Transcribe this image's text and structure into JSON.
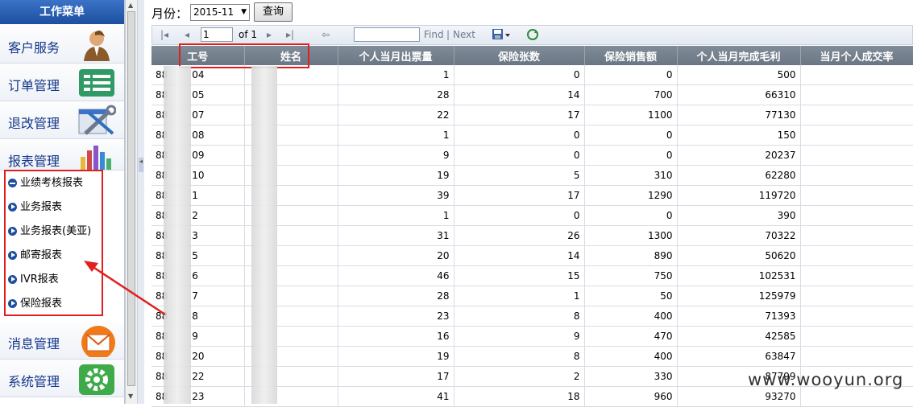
{
  "sidebar": {
    "title": "工作菜单",
    "categories": [
      {
        "label": "客户服务",
        "icon": "person-icon"
      },
      {
        "label": "订单管理",
        "icon": "list-icon"
      },
      {
        "label": "退改管理",
        "icon": "tools-icon"
      },
      {
        "label": "报表管理",
        "icon": "bar-chart-icon"
      },
      {
        "label": "消息管理",
        "icon": "mail-icon"
      },
      {
        "label": "系统管理",
        "icon": "gear-icon"
      }
    ],
    "report_items": [
      "业绩考核报表",
      "业务报表",
      "业务报表(美亚)",
      "邮寄报表",
      "IVR报表",
      "保险报表"
    ]
  },
  "filter": {
    "month_label": "月份：",
    "month_value": "2015-11",
    "query_label": "查询"
  },
  "toolbar": {
    "page_value": "1",
    "page_of": "of 1",
    "find_label": "Find",
    "separator": "|",
    "next_label": "Next"
  },
  "table": {
    "headers": [
      "工号",
      "姓名",
      "个人当月出票量",
      "保险张数",
      "保险销售额",
      "个人当月完成毛利",
      "当月个人成交率"
    ],
    "rows": [
      [
        "88",
        "04",
        "",
        "1",
        "0",
        "0",
        "500"
      ],
      [
        "88",
        "05",
        "",
        "28",
        "14",
        "700",
        "66310"
      ],
      [
        "88",
        "07",
        "",
        "22",
        "17",
        "1100",
        "77130"
      ],
      [
        "88",
        "08",
        "",
        "1",
        "0",
        "0",
        "150"
      ],
      [
        "88",
        "09",
        "",
        "9",
        "0",
        "0",
        "20237"
      ],
      [
        "88",
        "10",
        "",
        "19",
        "5",
        "310",
        "62280"
      ],
      [
        "88",
        "1",
        "",
        "39",
        "17",
        "1290",
        "119720"
      ],
      [
        "88",
        "2",
        "",
        "1",
        "0",
        "0",
        "390"
      ],
      [
        "88",
        "3",
        "",
        "31",
        "26",
        "1300",
        "70322"
      ],
      [
        "88",
        "5",
        "",
        "20",
        "14",
        "890",
        "50620"
      ],
      [
        "88",
        "6",
        "",
        "46",
        "15",
        "750",
        "102531"
      ],
      [
        "88",
        "7",
        "",
        "28",
        "1",
        "50",
        "125979"
      ],
      [
        "88",
        "8",
        "",
        "23",
        "8",
        "400",
        "71393"
      ],
      [
        "88",
        "9",
        "",
        "16",
        "9",
        "470",
        "42585"
      ],
      [
        "88",
        "20",
        "",
        "19",
        "8",
        "400",
        "63847"
      ],
      [
        "88",
        "22",
        "",
        "17",
        "2",
        "330",
        "87799"
      ],
      [
        "88",
        "23",
        "",
        "41",
        "18",
        "960",
        "93270"
      ]
    ]
  },
  "watermark": "www.wooyun.org",
  "colors": {
    "highlight_red": "#e02020",
    "header_bg": "#6a7683",
    "menu_blue": "#1d4f9e"
  }
}
